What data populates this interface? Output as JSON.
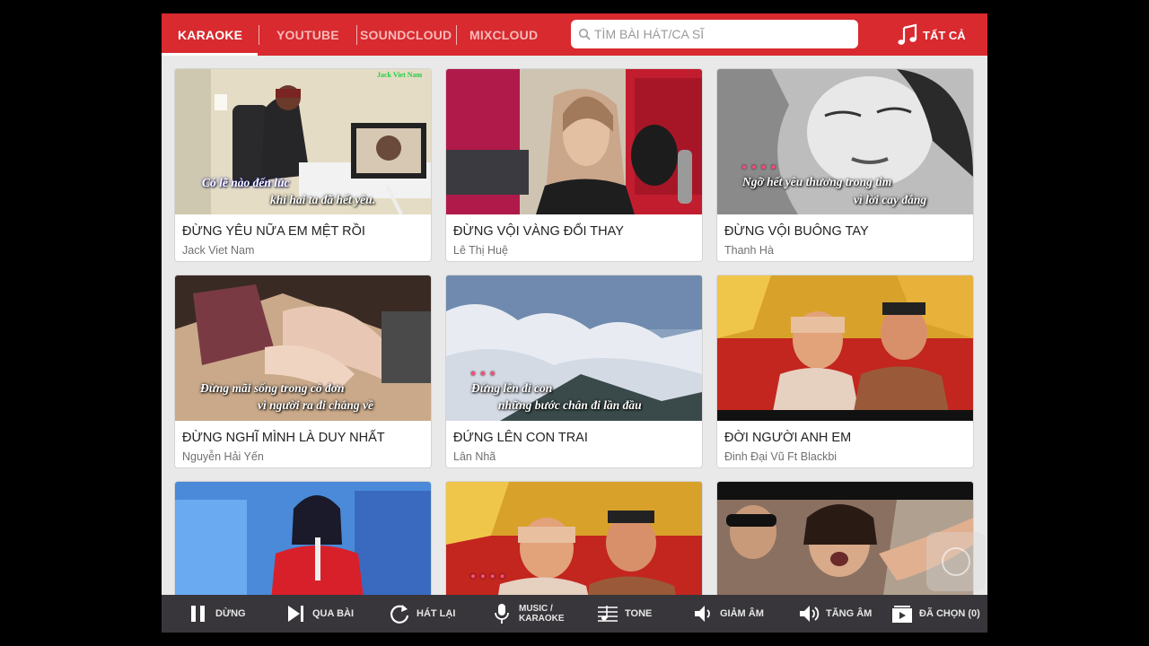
{
  "tabs": [
    {
      "label": "KARAOKE",
      "active": true
    },
    {
      "label": "YOUTUBE",
      "active": false
    },
    {
      "label": "SOUNDCLOUD",
      "active": false
    },
    {
      "label": "MIXCLOUD",
      "active": false
    }
  ],
  "search": {
    "placeholder": "TÌM BÀI HÁT/CA SĨ",
    "value": "",
    "icon": "search-icon"
  },
  "filter": {
    "label": "TẤT CẢ",
    "icon": "music-note-icon"
  },
  "cards": [
    {
      "title": "ĐỪNG YÊU NỮA EM MỆT RỒI",
      "artist": "Jack Viet Nam",
      "watermark": "Jack Viet Nam",
      "lyric1": "Có lẽ nào đến lúc",
      "lyric2": "khi hai ta đã hết yêu."
    },
    {
      "title": "ĐỪNG VỘI VÀNG ĐỔI THAY",
      "artist": "Lê Thị Huệ"
    },
    {
      "title": "ĐỪNG VỘI BUÔNG TAY",
      "artist": "Thanh Hà",
      "lyric1": "Ngỡ hết yêu thương trong tim",
      "lyric2": "vì lời cay đắng"
    },
    {
      "title": "ĐỪNG NGHĨ MÌNH LÀ DUY NHẤT",
      "artist": "Nguyễn Hải Yến",
      "lyric1": "Đừng mãi sống trong cô đơn",
      "lyric2": "vì người ra đi chẳng về"
    },
    {
      "title": "ĐỨNG LÊN CON TRAI",
      "artist": "Lân Nhã",
      "lyric1": "Đứng lên đi con",
      "lyric2": "những bước chân đi lần đầu"
    },
    {
      "title": "ĐỜI NGƯỜI ANH EM",
      "artist": "Đinh Đại Vũ Ft Blackbi"
    },
    {
      "title": "",
      "artist": ""
    },
    {
      "title": "",
      "artist": ""
    },
    {
      "title": "",
      "artist": ""
    }
  ],
  "controls": [
    {
      "label": "DỪNG",
      "icon": "pause-icon"
    },
    {
      "label": "QUA BÀI",
      "icon": "skip-next-icon"
    },
    {
      "label": "HÁT LẠI",
      "icon": "replay-icon"
    },
    {
      "label1": "MUSIC /",
      "label2": "KARAOKE",
      "icon": "microphone-icon"
    },
    {
      "label": "TONE",
      "icon": "tone-icon"
    },
    {
      "label": "GIẢM ÂM",
      "icon": "volume-down-icon"
    },
    {
      "label": "TĂNG ÂM",
      "icon": "volume-up-icon"
    },
    {
      "label": "ĐÃ CHỌN (0)",
      "icon": "playlist-icon"
    }
  ],
  "colors": {
    "accent": "#d82a2f",
    "control_bar": "#38363a",
    "background": "#e9e9ea"
  }
}
